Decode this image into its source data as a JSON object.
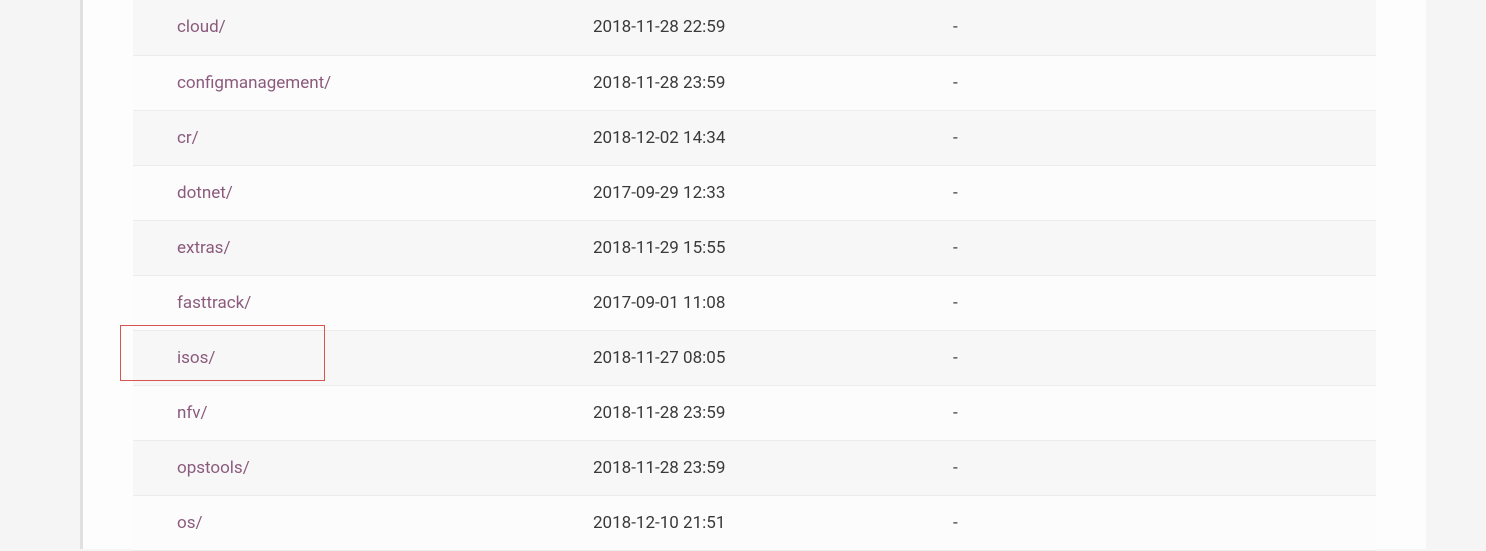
{
  "listing": {
    "rows": [
      {
        "name": "cloud/",
        "modified": "2018-11-28 22:59",
        "size": "-"
      },
      {
        "name": "configmanagement/",
        "modified": "2018-11-28 23:59",
        "size": "-"
      },
      {
        "name": "cr/",
        "modified": "2018-12-02 14:34",
        "size": "-"
      },
      {
        "name": "dotnet/",
        "modified": "2017-09-29 12:33",
        "size": "-"
      },
      {
        "name": "extras/",
        "modified": "2018-11-29 15:55",
        "size": "-"
      },
      {
        "name": "fasttrack/",
        "modified": "2017-09-01 11:08",
        "size": "-"
      },
      {
        "name": "isos/",
        "modified": "2018-11-27 08:05",
        "size": "-"
      },
      {
        "name": "nfv/",
        "modified": "2018-11-28 23:59",
        "size": "-"
      },
      {
        "name": "opstools/",
        "modified": "2018-11-28 23:59",
        "size": "-"
      },
      {
        "name": "os/",
        "modified": "2018-12-10 21:51",
        "size": "-"
      }
    ]
  },
  "colors": {
    "link": "#8b5a7d",
    "highlight": "#d9534f"
  }
}
